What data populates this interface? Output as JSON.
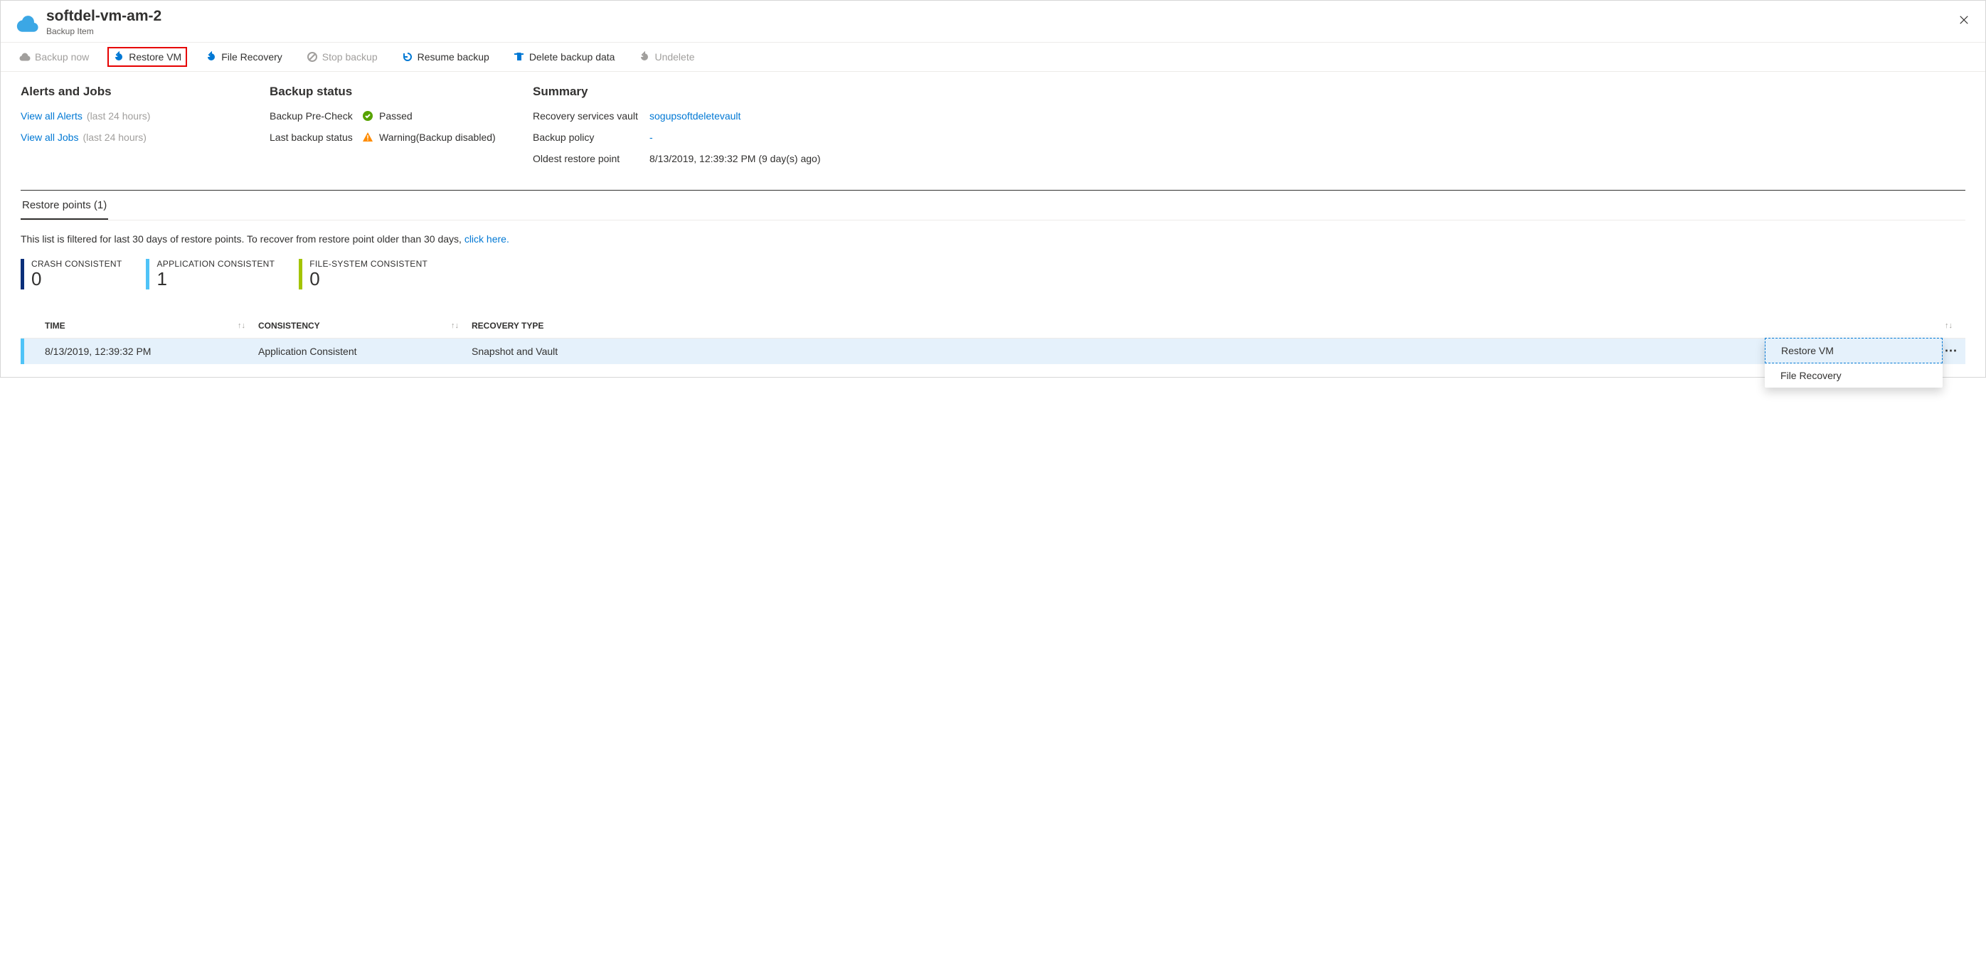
{
  "header": {
    "title": "softdel-vm-am-2",
    "subtitle": "Backup Item"
  },
  "toolbar": {
    "backup_now": "Backup now",
    "restore_vm": "Restore VM",
    "file_recovery": "File Recovery",
    "stop_backup": "Stop backup",
    "resume_backup": "Resume backup",
    "delete_backup_data": "Delete backup data",
    "undelete": "Undelete"
  },
  "alerts": {
    "title": "Alerts and Jobs",
    "view_alerts": "View all Alerts",
    "view_jobs": "View all Jobs",
    "range": "(last 24 hours)"
  },
  "backup_status": {
    "title": "Backup status",
    "precheck_label": "Backup Pre-Check",
    "precheck_value": "Passed",
    "last_backup_label": "Last backup status",
    "last_backup_value": "Warning(Backup disabled)"
  },
  "summary": {
    "title": "Summary",
    "vault_label": "Recovery services vault",
    "vault_value": "sogupsoftdeletevault",
    "policy_label": "Backup policy",
    "policy_value": "-",
    "oldest_label": "Oldest restore point",
    "oldest_value": "8/13/2019, 12:39:32 PM (9 day(s) ago)"
  },
  "tab": {
    "restore_points": "Restore points (1)"
  },
  "filter_text": "This list is filtered for last 30 days of restore points. To recover from restore point older than 30 days, ",
  "filter_link": "click here.",
  "counters": {
    "crash_label": "CRASH CONSISTENT",
    "crash_value": "0",
    "app_label": "APPLICATION CONSISTENT",
    "app_value": "1",
    "fs_label": "FILE-SYSTEM CONSISTENT",
    "fs_value": "0"
  },
  "columns": {
    "time": "TIME",
    "consistency": "CONSISTENCY",
    "recovery_type": "RECOVERY TYPE"
  },
  "row": {
    "time": "8/13/2019, 12:39:32 PM",
    "consistency": "Application Consistent",
    "recovery_type": "Snapshot and Vault"
  },
  "context_menu": {
    "restore_vm": "Restore VM",
    "file_recovery": "File Recovery"
  }
}
